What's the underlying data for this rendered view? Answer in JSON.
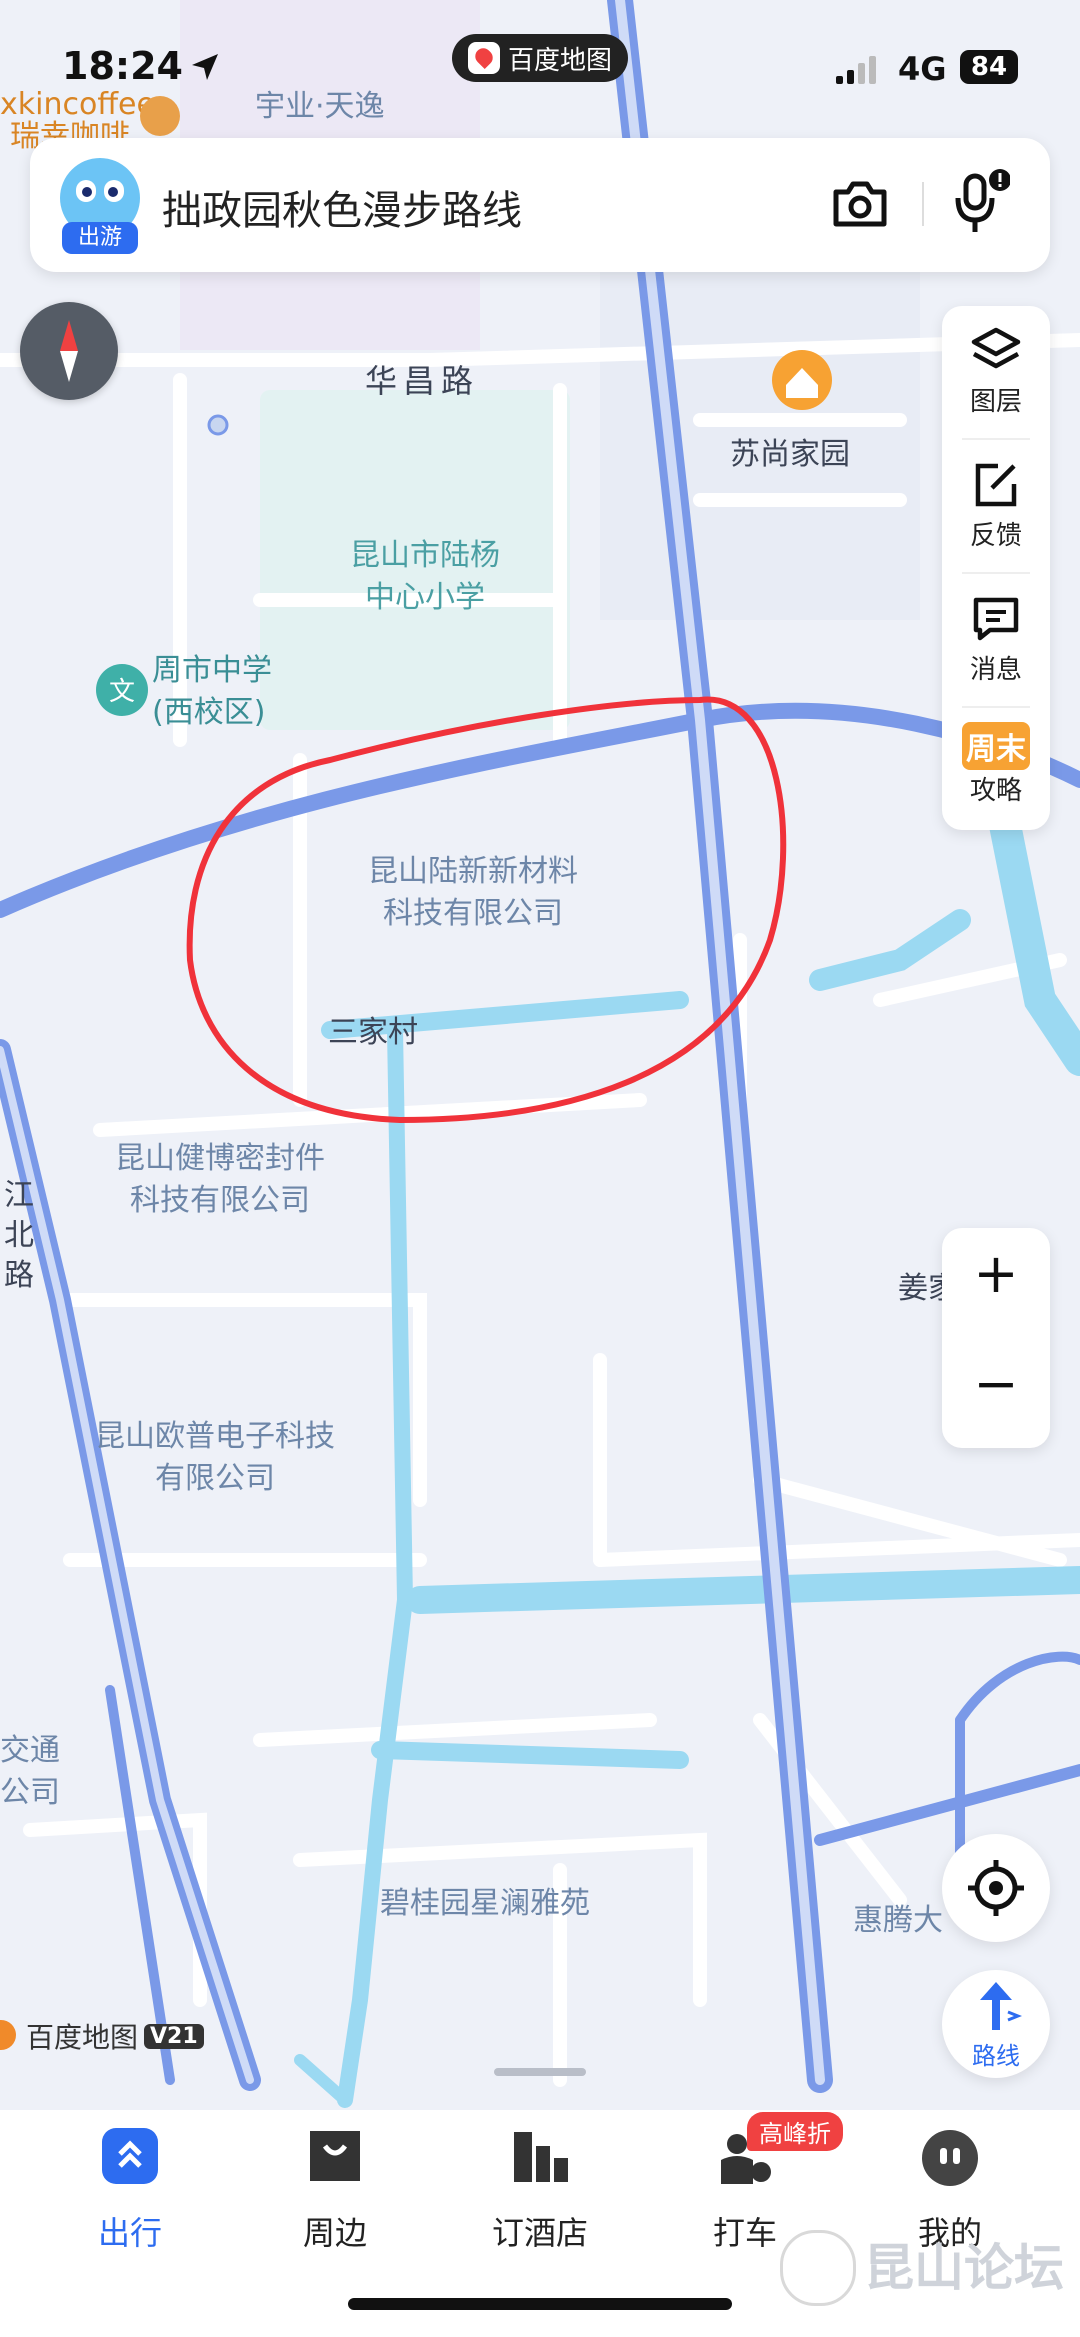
{
  "status_bar": {
    "time": "18:24",
    "network": "4G",
    "battery": "84",
    "app_badge": "百度地图"
  },
  "search": {
    "avatar_badge": "出游",
    "query": "拙政园秋色漫步路线"
  },
  "side_panel": {
    "items": [
      {
        "label": "图层",
        "icon": "layers-icon"
      },
      {
        "label": "反馈",
        "icon": "feedback-icon"
      },
      {
        "label": "消息",
        "icon": "message-icon"
      },
      {
        "label": "攻略",
        "icon": "weekend-icon",
        "badge": "周末"
      }
    ]
  },
  "map_labels": {
    "coffee": "xkincoffee",
    "coffee2": "瑞幸咖啡",
    "yuye": "宇业·天逸",
    "huachang": "华昌路",
    "sushang": "苏尚家园",
    "school": "昆山市陆杨\n中心小学",
    "zhoushi": "周市中学\n(西校区)",
    "lusin": "昆山陆新新材料\n科技有限公司",
    "sanjia": "三家村",
    "jianbo": "昆山健博密封件\n科技有限公司",
    "oupu": "昆山欧普电子科技\n有限公司",
    "bigui": "碧桂园星澜雅苑",
    "jiang": "姜家",
    "huiteng": "惠腾大",
    "jiaotong": "交通\n公司",
    "road_north": "江\n北\n路",
    "brand": "百度地图",
    "version": "V21"
  },
  "zoom": {
    "in": "+",
    "out": "−"
  },
  "route_button": {
    "label": "路线"
  },
  "bottom_nav": {
    "items": [
      {
        "label": "出行",
        "icon": "travel-icon",
        "active": true
      },
      {
        "label": "周边",
        "icon": "nearby-icon",
        "active": false
      },
      {
        "label": "订酒店",
        "icon": "hotel-icon",
        "active": false
      },
      {
        "label": "打车",
        "icon": "taxi-icon",
        "active": false,
        "badge": "高峰折"
      },
      {
        "label": "我的",
        "icon": "profile-icon",
        "active": false
      }
    ]
  },
  "watermark": "昆山论坛",
  "colors": {
    "accent": "#3370ff",
    "route": "#7a99e8",
    "water": "#9bd9f2",
    "annotation": "#f0323a",
    "badge_red": "#f04141"
  }
}
